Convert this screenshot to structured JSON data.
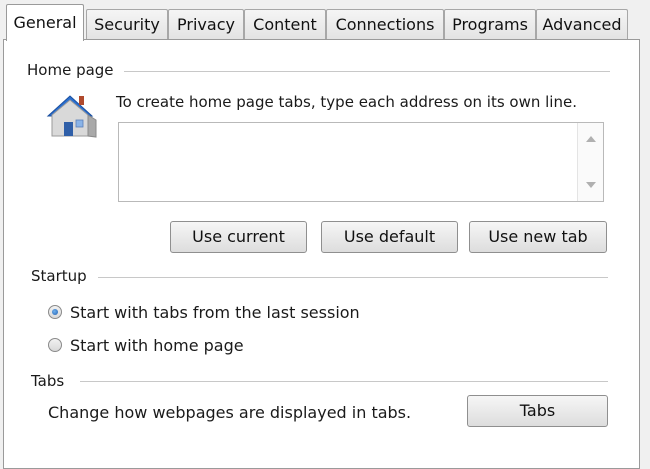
{
  "tabs": [
    {
      "label": "General",
      "active": true
    },
    {
      "label": "Security",
      "active": false
    },
    {
      "label": "Privacy",
      "active": false
    },
    {
      "label": "Content",
      "active": false
    },
    {
      "label": "Connections",
      "active": false
    },
    {
      "label": "Programs",
      "active": false
    },
    {
      "label": "Advanced",
      "active": false
    }
  ],
  "home_page": {
    "title": "Home page",
    "icon": "house-icon",
    "description": "To create home page tabs, type each address on its own line.",
    "addresses": "",
    "buttons": {
      "use_current": "Use current",
      "use_default": "Use default",
      "use_new_tab": "Use new tab"
    }
  },
  "startup": {
    "title": "Startup",
    "options": [
      {
        "label": "Start with tabs from the last session",
        "checked": true
      },
      {
        "label": "Start with home page",
        "checked": false
      }
    ]
  },
  "tabs_section": {
    "title": "Tabs",
    "description": "Change how webpages are displayed in tabs.",
    "button": "Tabs"
  },
  "colors": {
    "radio_selected": "#1f5fb0",
    "house_roof": "#2a6fd0"
  }
}
